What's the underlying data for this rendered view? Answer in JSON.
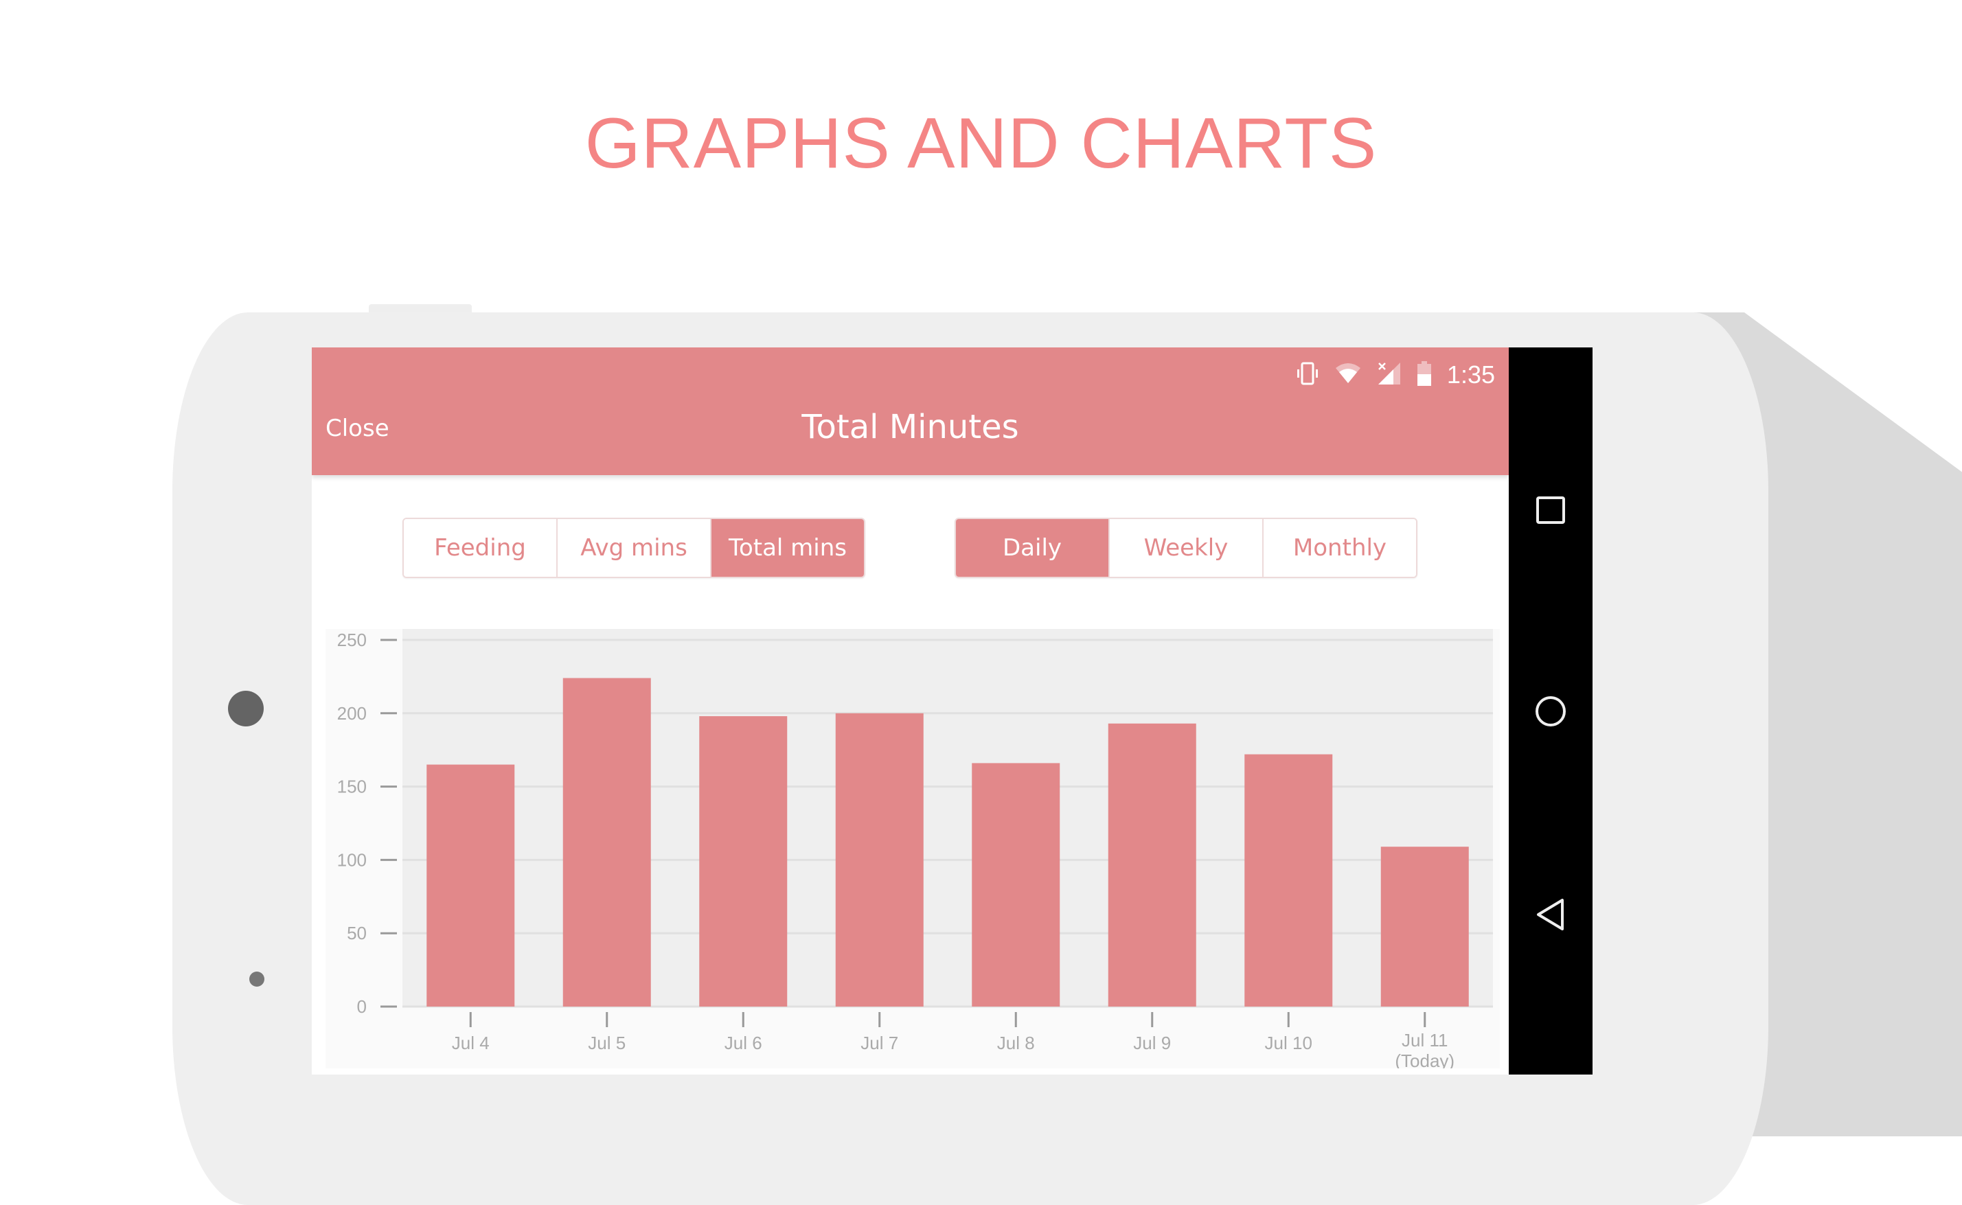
{
  "headline": "GRAPHS AND CHARTS",
  "status_bar": {
    "time": "1:35",
    "icons": [
      "vibrate-icon",
      "wifi-icon",
      "signal-no-data-icon",
      "battery-half-icon"
    ]
  },
  "app_bar": {
    "close_label": "Close",
    "title": "Total Minutes"
  },
  "metric_tabs": [
    {
      "label": "Feeding",
      "active": false
    },
    {
      "label": "Avg mins",
      "active": false
    },
    {
      "label": "Total mins",
      "active": true
    }
  ],
  "period_tabs": [
    {
      "label": "Daily",
      "active": true
    },
    {
      "label": "Weekly",
      "active": false
    },
    {
      "label": "Monthly",
      "active": false
    }
  ],
  "nav_bar": {
    "buttons": [
      "recents-icon",
      "home-icon",
      "back-icon"
    ]
  },
  "colors": {
    "accent": "#e2888a",
    "headline": "#f48585",
    "plot_bg": "#efefef",
    "axis_text": "#aaaaaa"
  },
  "chart_data": {
    "type": "bar",
    "title": "Total Minutes",
    "xlabel": "",
    "ylabel": "",
    "categories": [
      "Jul 4",
      "Jul 5",
      "Jul 6",
      "Jul 7",
      "Jul 8",
      "Jul 9",
      "Jul 10",
      "Jul 11\n(Today)"
    ],
    "values": [
      165,
      224,
      198,
      200,
      166,
      193,
      172,
      109
    ],
    "ylim": [
      0,
      250
    ],
    "yticks": [
      0,
      50,
      100,
      150,
      200,
      250
    ],
    "grid": true,
    "legend": "none"
  }
}
